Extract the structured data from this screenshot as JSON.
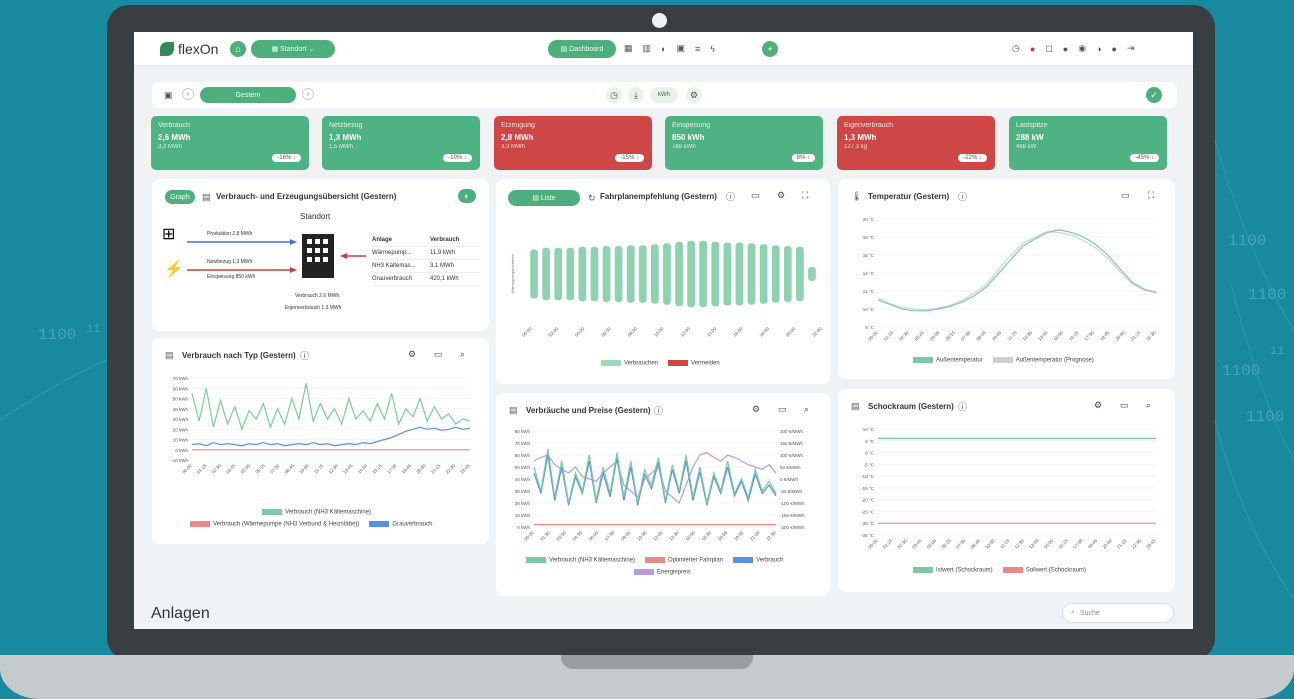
{
  "bg_text": [
    "1100",
    "11",
    "1100",
    "1100",
    "1100",
    "1100",
    "11"
  ],
  "header": {
    "brand": "flexOn",
    "location_label": "Standort",
    "dashboard_label": "Dashboard"
  },
  "toolbar": {
    "period": "Gestern",
    "unit": "kWh"
  },
  "kpis": [
    {
      "title": "Verbrauch",
      "value": "2,6 MWh",
      "sub": "3,2 MWh",
      "delta": "-16% ↓",
      "color": "green"
    },
    {
      "title": "Netzbezug",
      "value": "1,3 MWh",
      "sub": "1,5 MWh",
      "delta": "-10% ↓",
      "color": "green"
    },
    {
      "title": "Erzeugung",
      "value": "2,8 MWh",
      "sub": "3,3 MWh",
      "delta": "-15% ↓",
      "color": "red"
    },
    {
      "title": "Einspeisung",
      "value": "850 kWh",
      "sub": "788 kWh",
      "delta": "8% ↑",
      "color": "green"
    },
    {
      "title": "Eigenverbrauch",
      "value": "1,3 MWh",
      "sub": "127,3 kg",
      "delta": "-22% ↓",
      "color": "red"
    },
    {
      "title": "Lastspitze",
      "value": "288 kW",
      "sub": "468 kW",
      "delta": "-45% ↓",
      "color": "green"
    }
  ],
  "overview": {
    "graph_btn": "Graph",
    "title": "Verbrauch- und Erzeugungsübersicht (Gestern)",
    "site": "Standort",
    "flows": [
      "Produktion 2,8 MWh",
      "Netzbezug 1,3 MWh",
      "Einspeisung 850 kWh"
    ],
    "bottom": [
      "Verbrauch 2,6 MWh",
      "Eigenverbrauch 1,3 MWh"
    ],
    "table_head": [
      "Anlage",
      "Verbrauch"
    ],
    "table_rows": [
      [
        "Wärmepump...",
        "11,9 kWh"
      ],
      [
        "NH3 Kältemas...",
        "3,1 MWh"
      ],
      [
        "Grauverbrauch",
        "420,1 kWh"
      ]
    ]
  },
  "fahrplan": {
    "list_btn": "Liste",
    "title": "Fahrplanempfehlung (Gestern)",
    "ylabel": "Wärmepumpenbetrieb",
    "legend": [
      "Verbrauchen",
      "Vermeiden"
    ]
  },
  "temp": {
    "title": "Temperatur (Gestern)",
    "legend": [
      "Außentemperatur",
      "Außentemperatur (Prognose)"
    ]
  },
  "vtyp": {
    "title": "Verbrauch nach Typ (Gestern)",
    "legend": [
      "Verbrauch (NH3 Kältemaschine)",
      "Verbrauch (Wärmepumpe (NH3 Verbund & Heizstäbe))",
      "Grauverbrauch"
    ]
  },
  "preise": {
    "title": "Verbräuche und Preise (Gestern)",
    "legend": [
      "Verbrauch (NH3 Kältemaschine)",
      "Optimierter Fahrplan",
      "Verbrauch",
      "Energiepreis"
    ]
  },
  "schock": {
    "title": "Schockraum (Gestern)",
    "legend": [
      "Istwert (Schockraum)",
      "Sollwert (Schockraum)"
    ]
  },
  "footer": {
    "title": "Anlagen",
    "search_placeholder": "Suche"
  },
  "chart_data": [
    {
      "type": "bar",
      "title": "Fahrplanempfehlung (Gestern)",
      "categories": [
        "00:00",
        "01:00",
        "02:00",
        "03:00",
        "04:00",
        "05:00",
        "06:00",
        "07:00",
        "08:00",
        "09:00",
        "10:00",
        "11:00",
        "12:00",
        "13:00",
        "14:00",
        "15:00",
        "16:00",
        "17:00",
        "18:00",
        "19:00",
        "20:00",
        "21:00",
        "22:00",
        "23:00"
      ],
      "series": [
        {
          "name": "Verbrauchen",
          "values": [
            0.7,
            0.75,
            0.75,
            0.75,
            0.78,
            0.78,
            0.8,
            0.8,
            0.82,
            0.82,
            0.85,
            0.88,
            0.92,
            0.95,
            0.95,
            0.92,
            0.9,
            0.9,
            0.88,
            0.85,
            0.82,
            0.8,
            0.78,
            0.2
          ]
        }
      ],
      "xtick_labels": [
        "00:00",
        "02:00",
        "04:00",
        "06:00",
        "08:00",
        "10:00",
        "12:00",
        "14:00",
        "16:00",
        "18:00",
        "20:00",
        "22:00"
      ]
    },
    {
      "type": "line",
      "title": "Temperatur (Gestern)",
      "ytick_labels": [
        "20 °C",
        "18 °C",
        "16 °C",
        "14 °C",
        "12 °C",
        "10 °C",
        "8 °C"
      ],
      "ylim": [
        8,
        20
      ],
      "xtick_labels": [
        "00:00",
        "01:15",
        "02:30",
        "03:45",
        "05:00",
        "06:15",
        "07:30",
        "08:45",
        "10:00",
        "11:15",
        "12:30",
        "13:45",
        "15:00",
        "16:15",
        "17:30",
        "18:45",
        "20:00",
        "21:15",
        "22:30"
      ],
      "series": [
        {
          "name": "Außentemperatur",
          "values": [
            11,
            10.5,
            10,
            9.8,
            9.8,
            10,
            10.3,
            10.8,
            11.5,
            12.5,
            14,
            15.5,
            17,
            17.8,
            18.5,
            18.8,
            18.5,
            18,
            17.2,
            16,
            14.5,
            13,
            12.2,
            11.8
          ]
        },
        {
          "name": "Außentemperatur (Prognose)",
          "values": [
            11.2,
            10.6,
            10.2,
            10,
            9.9,
            10.1,
            10.4,
            11,
            11.8,
            12.8,
            14.4,
            16,
            17.3,
            18,
            18.6,
            18.5,
            18.2,
            17.6,
            16.8,
            15.6,
            14.2,
            12.8,
            12.1,
            11.9
          ]
        }
      ]
    },
    {
      "type": "line",
      "title": "Verbrauch nach Typ (Gestern)",
      "ytick_labels": [
        "70 kWh",
        "60 kWh",
        "50 kWh",
        "40 kWh",
        "30 kWh",
        "20 kWh",
        "10 kWh",
        "0 kWh",
        "-10 kWh"
      ],
      "ylim": [
        -10,
        70
      ],
      "xtick_labels": [
        "00:00",
        "01:15",
        "02:30",
        "03:45",
        "05:00",
        "06:15",
        "07:30",
        "08:45",
        "10:00",
        "11:15",
        "12:30",
        "13:45",
        "15:00",
        "16:15",
        "17:30",
        "18:45",
        "20:00",
        "21:15",
        "22:30",
        "23:45"
      ],
      "series": [
        {
          "name": "Verbrauch (NH3 Kältemaschine)",
          "values": [
            55,
            28,
            60,
            22,
            48,
            25,
            42,
            20,
            38,
            30,
            45,
            22,
            40,
            25,
            50,
            30,
            65,
            28,
            45,
            30,
            40,
            25,
            50,
            30,
            38,
            28,
            45,
            30,
            55,
            25,
            40,
            32,
            50,
            28,
            42,
            30,
            35,
            25,
            30,
            28
          ]
        },
        {
          "name": "Verbrauch (Wärmepumpe (NH3 Verbund & Heizstäbe))",
          "values": [
            0,
            0,
            0,
            0,
            0,
            0,
            0,
            0,
            0,
            0,
            0,
            0,
            0,
            0,
            0,
            0,
            0,
            0,
            0,
            0,
            0,
            0,
            0,
            0,
            0,
            0,
            0,
            0,
            0,
            0,
            0,
            0,
            0,
            0,
            0,
            0,
            0,
            0,
            0,
            0
          ]
        },
        {
          "name": "Grauverbrauch",
          "values": [
            5,
            6,
            4,
            7,
            5,
            6,
            5,
            4,
            6,
            5,
            7,
            5,
            6,
            4,
            5,
            6,
            5,
            7,
            5,
            6,
            4,
            5,
            6,
            5,
            7,
            6,
            8,
            10,
            12,
            15,
            18,
            20,
            22,
            20,
            21,
            19,
            20,
            22,
            20,
            21
          ]
        }
      ]
    },
    {
      "type": "line",
      "title": "Verbräuche und Preise (Gestern)",
      "ytick_labels": [
        "80 kWh",
        "70 kWh",
        "60 kWh",
        "50 kWh",
        "40 kWh",
        "30 kWh",
        "20 kWh",
        "10 kWh",
        "0 kWh"
      ],
      "y2tick_labels": [
        "200 €/MWh",
        "150 €/MWh",
        "100 €/MWh",
        "50 €/MWh",
        "0 €/MWh",
        "-50 €/MWh",
        "-100 €/MWh",
        "-150 €/MWh",
        "-200 €/MWh"
      ],
      "ylim": [
        0,
        80
      ],
      "xtick_labels": [
        "00:00",
        "01:30",
        "03:00",
        "04:30",
        "06:00",
        "07:30",
        "09:00",
        "10:30",
        "12:00",
        "13:30",
        "15:00",
        "16:30",
        "18:00",
        "19:30",
        "21:00",
        "22:30"
      ],
      "series": [
        {
          "name": "Verbrauch (NH3 Kältemaschine)",
          "values": [
            50,
            30,
            65,
            25,
            55,
            20,
            45,
            30,
            60,
            22,
            50,
            28,
            62,
            25,
            55,
            20,
            48,
            35,
            58,
            22,
            52,
            30,
            60,
            25,
            50,
            20,
            45,
            30,
            55,
            28,
            40,
            25,
            48,
            30,
            38,
            28
          ]
        },
        {
          "name": "Optimierter Fahrplan",
          "values": [
            2,
            2,
            2,
            2,
            2,
            2,
            2,
            2,
            2,
            2,
            2,
            2,
            2,
            2,
            2,
            2,
            2,
            2,
            2,
            2,
            2,
            2,
            2,
            2,
            2,
            2,
            2,
            2,
            2,
            2,
            2,
            2,
            2,
            2,
            2,
            2
          ]
        },
        {
          "name": "Verbrauch",
          "values": [
            45,
            28,
            60,
            22,
            50,
            18,
            42,
            28,
            55,
            20,
            45,
            25,
            58,
            22,
            50,
            18,
            44,
            32,
            54,
            20,
            48,
            28,
            55,
            22,
            46,
            18,
            42,
            28,
            50,
            26,
            38,
            22,
            44,
            28,
            35,
            26
          ]
        },
        {
          "name": "Energiepreis",
          "values": [
            55,
            58,
            60,
            52,
            48,
            45,
            50,
            42,
            40,
            38,
            45,
            50,
            55,
            35,
            30,
            25,
            40,
            45,
            50,
            30,
            25,
            20,
            35,
            50,
            60,
            62,
            58,
            55,
            60,
            58,
            55,
            52,
            50,
            48,
            52,
            45
          ]
        }
      ]
    },
    {
      "type": "line",
      "title": "Schockraum (Gestern)",
      "ytick_labels": [
        "10 °C",
        "5 °C",
        "0 °C",
        "-5 °C",
        "-10 °C",
        "-15 °C",
        "-20 °C",
        "-25 °C",
        "-30 °C",
        "-35 °C"
      ],
      "ylim": [
        -35,
        10
      ],
      "xtick_labels": [
        "00:00",
        "01:15",
        "02:30",
        "03:45",
        "05:00",
        "06:15",
        "07:30",
        "08:45",
        "10:00",
        "11:15",
        "12:30",
        "13:45",
        "15:00",
        "16:15",
        "17:30",
        "18:45",
        "20:00",
        "21:15",
        "22:30",
        "23:45"
      ],
      "series": [
        {
          "name": "Istwert (Schockraum)",
          "values": [
            6,
            6,
            6,
            6,
            6,
            6,
            6,
            6,
            6,
            6
          ]
        },
        {
          "name": "Sollwert (Schockraum)",
          "values": [
            -30,
            -30,
            -30,
            -30,
            -30,
            -30,
            -30,
            -30,
            -30,
            -30
          ]
        }
      ]
    }
  ],
  "colors": {
    "green": "#4fb283",
    "red": "#cf4646",
    "teal": "#178aa0",
    "line_green": "#7cc9a6",
    "line_blue": "#5b8fe0",
    "line_pink": "#e88a8a",
    "line_purple": "#b79ae0"
  }
}
